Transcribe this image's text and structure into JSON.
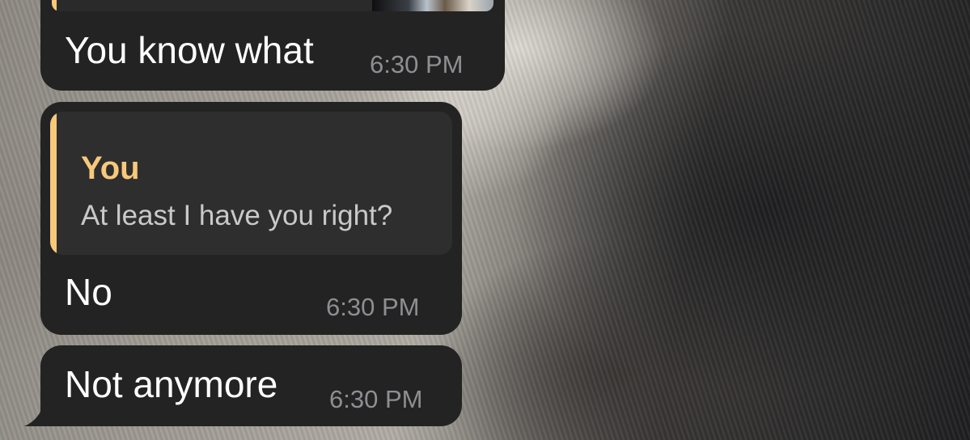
{
  "chat": {
    "messages": [
      {
        "text": "You know what",
        "time": "6:30 PM",
        "has_media_above": true
      },
      {
        "reply": {
          "author": "You",
          "text": "At least I have you right?"
        },
        "text": "No",
        "time": "6:30 PM"
      },
      {
        "text": "Not anymore",
        "time": "6:30 PM",
        "has_tail": true
      }
    ]
  },
  "colors": {
    "bubble_bg": "#232323",
    "reply_bg": "#2e2e2e",
    "accent": "#f7c97a",
    "time_text": "#8e8e93",
    "reply_text": "#c9c9c9"
  },
  "background": {
    "type": "wallpaper-photo",
    "subject": "fur"
  }
}
